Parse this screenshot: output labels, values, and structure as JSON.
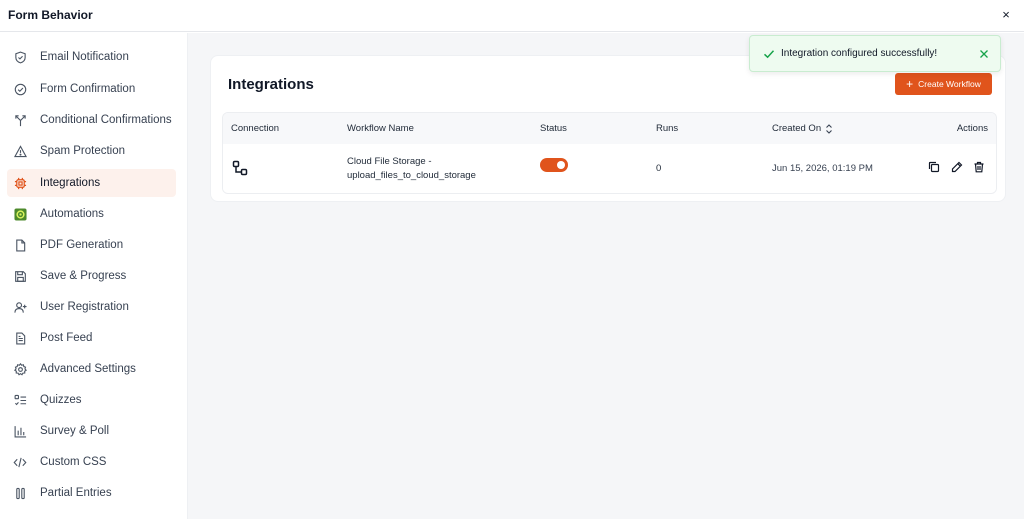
{
  "window": {
    "title": "Form Behavior",
    "close_label": "×"
  },
  "sidebar": {
    "items": [
      {
        "label": "Email Notification",
        "icon": "shield-check-icon",
        "active": false
      },
      {
        "label": "Form Confirmation",
        "icon": "check-circle-icon",
        "active": false
      },
      {
        "label": "Conditional Confirmations",
        "icon": "branch-icon",
        "active": false
      },
      {
        "label": "Spam Protection",
        "icon": "warning-triangle-icon",
        "active": false
      },
      {
        "label": "Integrations",
        "icon": "integration-chip-icon",
        "active": true
      },
      {
        "label": "Automations",
        "icon": "automation-icon",
        "active": false
      },
      {
        "label": "PDF Generation",
        "icon": "file-icon",
        "active": false
      },
      {
        "label": "Save & Progress",
        "icon": "save-icon",
        "active": false
      },
      {
        "label": "User Registration",
        "icon": "user-add-icon",
        "active": false
      },
      {
        "label": "Post Feed",
        "icon": "document-icon",
        "active": false
      },
      {
        "label": "Advanced Settings",
        "icon": "gear-icon",
        "active": false
      },
      {
        "label": "Quizzes",
        "icon": "checklist-icon",
        "active": false
      },
      {
        "label": "Survey & Poll",
        "icon": "bar-chart-icon",
        "active": false
      },
      {
        "label": "Custom CSS",
        "icon": "code-icon",
        "active": false
      },
      {
        "label": "Partial Entries",
        "icon": "columns-icon",
        "active": false
      }
    ]
  },
  "main": {
    "title": "Integrations",
    "create_button": {
      "label": "Create Workflow",
      "icon": "plus-icon"
    },
    "table": {
      "headers": {
        "connection": "Connection",
        "workflow_name": "Workflow Name",
        "status": "Status",
        "runs": "Runs",
        "created_on": "Created On",
        "actions": "Actions"
      },
      "rows": [
        {
          "connection_icon": "connection-icon",
          "workflow_name_line1": "Cloud File Storage -",
          "workflow_name_line2": "upload_files_to_cloud_storage",
          "status_on": true,
          "runs": "0",
          "created_on": "Jun 15, 2026, 01:19 PM",
          "actions": [
            "copy-icon",
            "edit-icon",
            "trash-icon"
          ]
        }
      ]
    }
  },
  "toast": {
    "message": "Integration configured successfully!",
    "icon": "check-icon",
    "close_icon": "close-icon"
  },
  "colors": {
    "accent": "#e0541c",
    "active_bg": "#fdf1ec",
    "toast_bg": "#eefbf0",
    "toast_check": "#16a34a"
  }
}
